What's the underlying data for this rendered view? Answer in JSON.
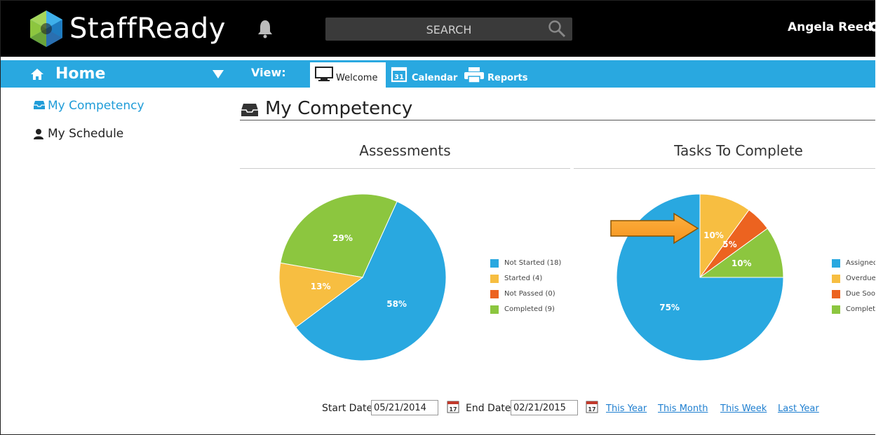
{
  "app": {
    "brand": "StaffReady",
    "search_placeholder": "SEARCH",
    "user_name": "Angela Reed"
  },
  "nav": {
    "home_label": "Home",
    "view_label": "View:",
    "tabs": [
      {
        "label": "Welcome",
        "icon": "monitor-icon",
        "active": true
      },
      {
        "label": "Calendar",
        "icon": "calendar-icon",
        "active": false
      },
      {
        "label": "Reports",
        "icon": "printer-icon",
        "active": false
      }
    ]
  },
  "sidebar": {
    "items": [
      {
        "label": "My Competency",
        "icon": "inbox-icon",
        "active": true
      },
      {
        "label": "My Schedule",
        "icon": "user-icon",
        "active": false
      }
    ]
  },
  "main": {
    "title": "My Competency",
    "sections": [
      "Assessments",
      "Tasks To Complete"
    ]
  },
  "colors": {
    "blue": "#29a8e0",
    "yellow": "#f7be41",
    "orange": "#ec6320",
    "green": "#8cc63f",
    "arrow": "#f7941d"
  },
  "chart_data": [
    {
      "type": "pie",
      "title": "Assessments",
      "labels": [
        "Not Started (18)",
        "Started (4)",
        "Not Passed (0)",
        "Completed (9)"
      ],
      "values": [
        58,
        13,
        0,
        29
      ],
      "value_labels": [
        "58%",
        "13%",
        "",
        "29%"
      ],
      "legend_position": "right"
    },
    {
      "type": "pie",
      "title": "Tasks To Complete",
      "labels": [
        "Assigned",
        "Overdue",
        "Due Soon",
        "Complete"
      ],
      "values": [
        75,
        10,
        5,
        10
      ],
      "value_labels": [
        "75%",
        "10%",
        "5%",
        "10%"
      ],
      "legend_position": "right"
    }
  ],
  "filters": {
    "start_label": "Start Date",
    "start_value": "05/21/2014",
    "end_label": "End Date",
    "end_value": "02/21/2015",
    "links": [
      "This Year",
      "This Month",
      "This Week",
      "Last Year"
    ]
  }
}
